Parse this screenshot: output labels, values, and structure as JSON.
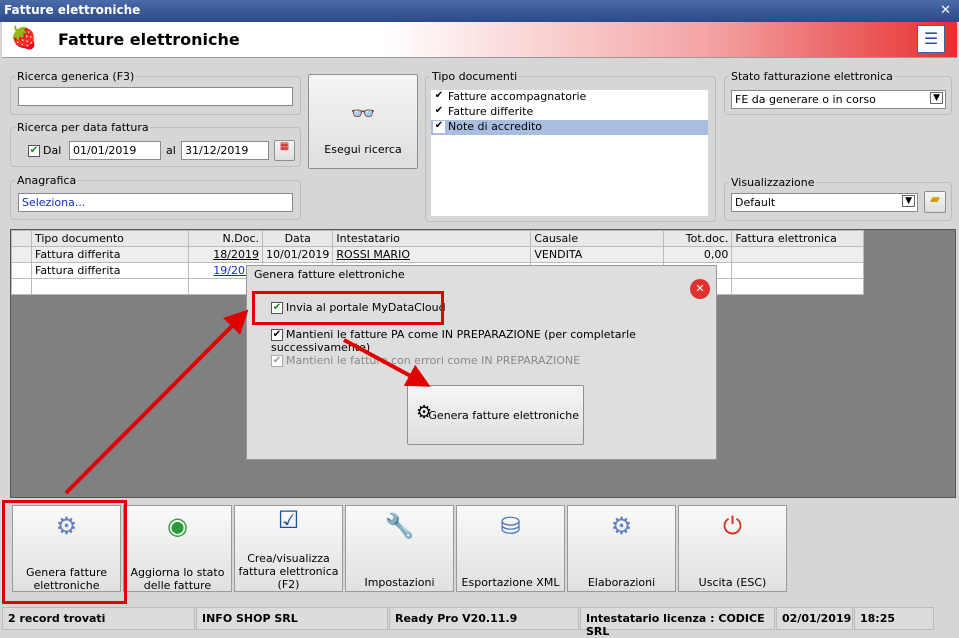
{
  "window": {
    "title": "Fatture elettroniche",
    "header_title": "Fatture elettroniche"
  },
  "search": {
    "generic_label": "Ricerca generica (F3)",
    "generic_value": "",
    "date_label": "Ricerca per data fattura",
    "dal_label": "Dal",
    "dal_value": "01/01/2019",
    "al_label": "al",
    "al_value": "31/12/2019",
    "anagrafica_label": "Anagrafica",
    "anagrafica_value": "Seleziona...",
    "search_button": "Esegui ricerca"
  },
  "tipo_documenti": {
    "label": "Tipo documenti",
    "items": [
      {
        "label": "Fatture accompagnatorie",
        "checked": true
      },
      {
        "label": "Fatture differite",
        "checked": true
      },
      {
        "label": "Note di accredito",
        "checked": true
      }
    ]
  },
  "stato": {
    "label": "Stato fatturazione elettronica",
    "value": "FE da generare o in corso"
  },
  "visualizzazione": {
    "label": "Visualizzazione",
    "value": "Default"
  },
  "table": {
    "columns": [
      "Tipo documento",
      "N.Doc.",
      "Data",
      "Intestatario",
      "Causale",
      "Tot.doc.",
      "Fattura elettronica"
    ],
    "rows": [
      [
        "Fattura differita",
        "18/2019",
        "10/01/2019",
        "ROSSI MARIO",
        "VENDITA",
        "0,00",
        ""
      ],
      [
        "Fattura differita",
        "19/2019",
        "",
        "",
        "",
        "",
        ""
      ]
    ]
  },
  "dialog": {
    "title": "Genera fatture elettroniche",
    "options": [
      {
        "label": "Invia al portale MyDataCloud",
        "checked": true,
        "enabled": true
      },
      {
        "label": "Mantieni le fatture PA come IN PREPARAZIONE (per completarle successivamente)",
        "checked": true,
        "enabled": true
      },
      {
        "label": "Mantieni le fatture con errori come IN PREPARAZIONE",
        "checked": true,
        "enabled": false
      }
    ],
    "button": "Genera fatture elettroniche"
  },
  "toolbar": [
    {
      "label": "Genera fatture elettroniche",
      "icon": "gear-doc-icon"
    },
    {
      "label": "Aggiorna lo stato delle fatture",
      "icon": "globe-icon"
    },
    {
      "label": "Crea/visualizza fattura elettronica (F2)",
      "icon": "grid-check-icon"
    },
    {
      "label": "Impostazioni",
      "icon": "wrench-icon"
    },
    {
      "label": "Esportazione XML",
      "icon": "database-icon"
    },
    {
      "label": "Elaborazioni",
      "icon": "gear-doc-icon"
    },
    {
      "label": "Uscita (ESC)",
      "icon": "power-icon"
    }
  ],
  "statusbar": [
    "2 record trovati",
    "INFO SHOP SRL",
    "Ready Pro V20.11.9",
    "Intestatario licenza : CODICE SRL",
    "02/01/2019",
    "18:25"
  ],
  "colors": {
    "highlight": "#e00000",
    "selection": "#a8bde0"
  }
}
